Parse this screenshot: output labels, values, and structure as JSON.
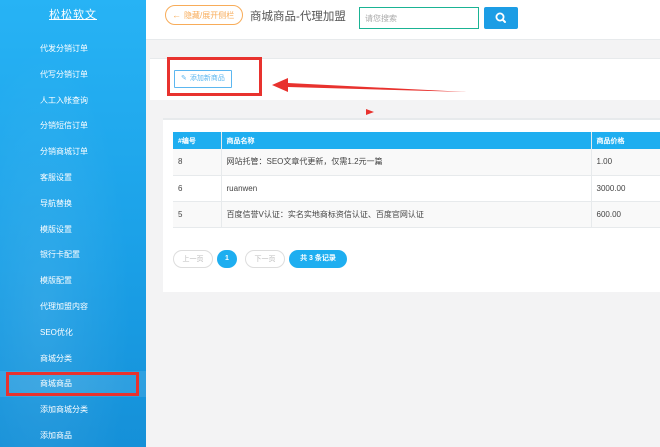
{
  "sidebar": {
    "brand": "松松软文",
    "items": [
      {
        "label": "代发分销订单"
      },
      {
        "label": "代写分销订单"
      },
      {
        "label": "人工入帐查询"
      },
      {
        "label": "分销短信订单"
      },
      {
        "label": "分销商城订单"
      },
      {
        "label": "客服设置"
      },
      {
        "label": "导航替换"
      },
      {
        "label": "模版设置"
      },
      {
        "label": "银行卡配置"
      },
      {
        "label": "模版配置"
      },
      {
        "label": "代理加盟内容"
      },
      {
        "label": "SEO优化"
      },
      {
        "label": "商城分类"
      },
      {
        "label": "商城商品"
      },
      {
        "label": "添加商城分类"
      },
      {
        "label": "添加商品"
      }
    ]
  },
  "header": {
    "toggle_label": "隐藏/展开侧栏",
    "title": "商城商品-代理加盟",
    "search_placeholder": "请您搜索"
  },
  "toolbar": {
    "add_label": "添加新商品"
  },
  "table": {
    "headers": [
      "#编号",
      "商品名称",
      "商品价格"
    ],
    "rows": [
      {
        "id": "8",
        "name": "网站托管：SEO文章代更新，仅需1.2元一篇",
        "price": "1.00"
      },
      {
        "id": "6",
        "name": "ruanwen",
        "price": "3000.00"
      },
      {
        "id": "5",
        "name": "百度信誉V认证：实名实地商标资信认证、百度官网认证",
        "price": "600.00"
      }
    ]
  },
  "pager": {
    "prev": "上一页",
    "current": "1",
    "next": "下一页",
    "total": "共 3 条记录"
  },
  "colors": {
    "sidebar": "#1c9de5",
    "accent": "#1eaef0",
    "highlight": "#e8322e",
    "toggle": "#f8ac59"
  }
}
